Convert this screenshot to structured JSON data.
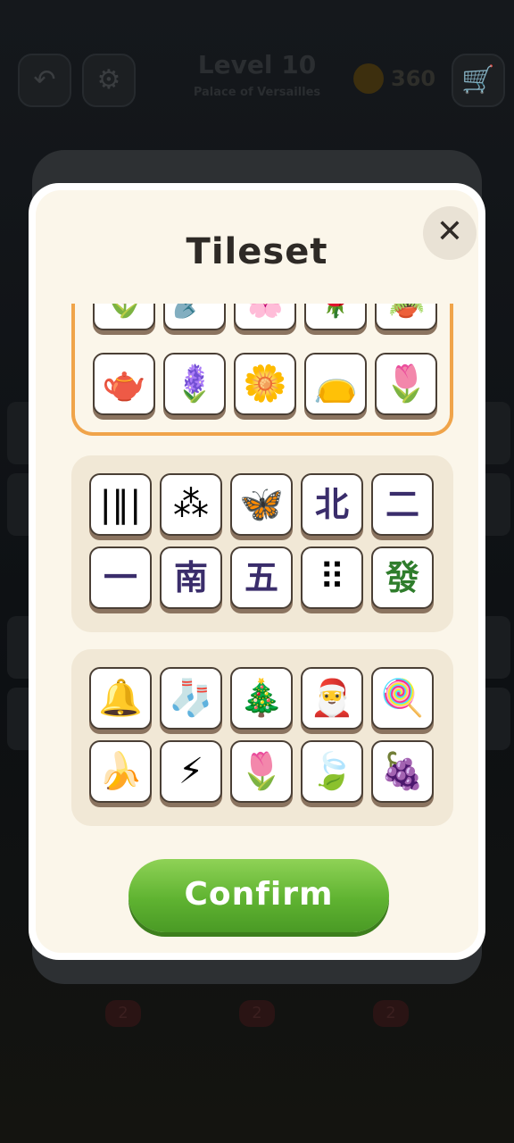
{
  "background": {
    "level_title": "Level 10",
    "level_subtitle": "Palace of Versailles",
    "coins": "360",
    "badge_values": [
      "2",
      "2",
      "2"
    ],
    "icons": {
      "back": "back-arrow-icon",
      "settings": "gear-icon",
      "shop": "cart-icon",
      "coin": "coin-icon"
    }
  },
  "modal": {
    "title": "Tileset",
    "close_label": "✕",
    "confirm_label": "Confirm",
    "tilesets": [
      {
        "name_hidden": true,
        "selected": true,
        "accent_color": "#f0a44a",
        "rows": [
          [
            "tulip-icon",
            "shovel-icon",
            "cherry-blossom-icon",
            "rose-icon",
            "flower-pot-icon"
          ],
          [
            "watering-can-icon",
            "hyacinth-icon",
            "blue-flower-icon",
            "seed-sack-icon",
            "purple-tulip-icon"
          ]
        ],
        "glyphs": [
          [
            "🌷",
            "🪏",
            "🌸",
            "🌹",
            "🪴"
          ],
          [
            "🫖",
            "🪻",
            "🌼",
            "👝",
            "🌷"
          ]
        ]
      },
      {
        "selected": false,
        "rows": [
          [
            "bamboo-tile-icon",
            "circle-tile-icon",
            "butterfly-icon",
            "north-char",
            "two-char"
          ],
          [
            "one-char",
            "south-char",
            "five-char",
            "nine-circles-icon",
            "green-dragon-char"
          ]
        ],
        "glyphs": [
          [
            "|‖|",
            "⁂",
            "🦋",
            "北",
            "二"
          ],
          [
            "一",
            "南",
            "五",
            "⠿",
            "發"
          ]
        ]
      },
      {
        "selected": false,
        "rows": [
          [
            "bell-icon",
            "stocking-icon",
            "christmas-tree-icon",
            "santa-hat-icon",
            "candy-cane-icon"
          ],
          [
            "banana-icon",
            "lightning-icon",
            "yellow-tulip-icon",
            "leaf-icon",
            "grapes-icon"
          ]
        ],
        "glyphs": [
          [
            "🔔",
            "🧦",
            "🎄",
            "🎅",
            "🍭"
          ],
          [
            "🍌",
            "⚡",
            "🌷",
            "🍃",
            "🍇"
          ]
        ]
      }
    ]
  },
  "colors": {
    "modal_bg": "#fbf6ea",
    "tileset_bg": "#f1e8d6",
    "confirm_green": "#5fb331",
    "selected_border": "#f0a44a",
    "char_purple": "#3a2d6b",
    "char_green": "#2f7d2c"
  }
}
